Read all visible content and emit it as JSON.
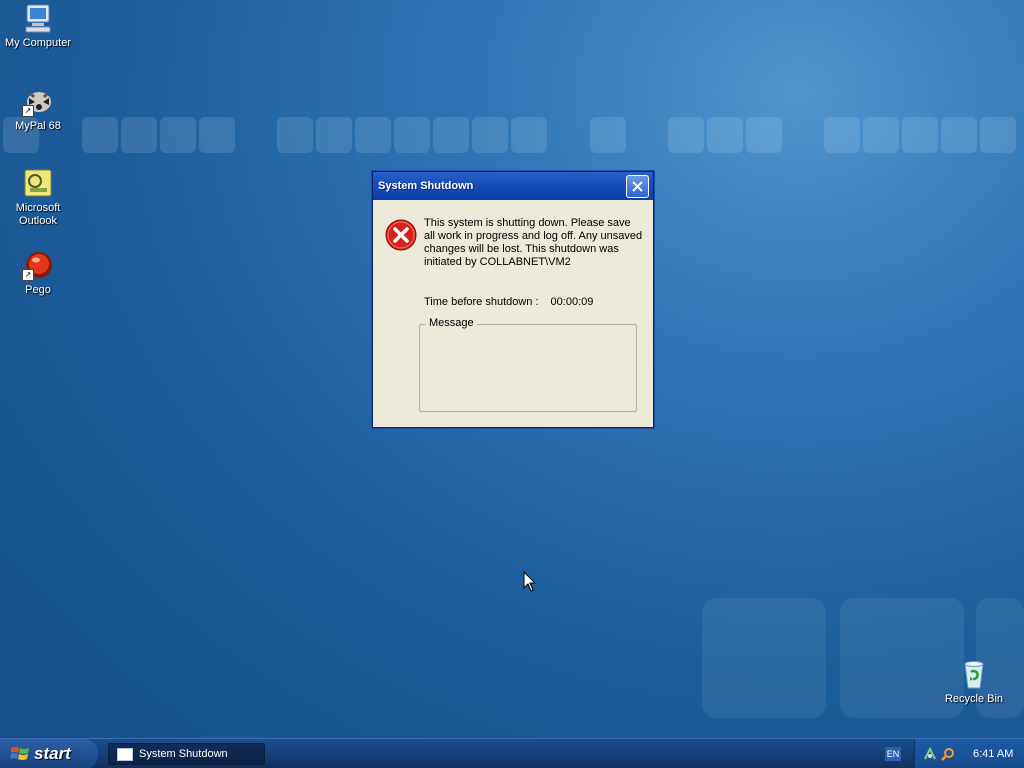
{
  "desktop": {
    "icons": [
      {
        "label": "My Computer",
        "icon": "my-computer-icon"
      },
      {
        "label": "MyPal 68",
        "icon": "mypal-icon"
      },
      {
        "label": "Microsoft Outlook",
        "icon": "outlook-icon"
      },
      {
        "label": "Pego",
        "icon": "pego-icon"
      },
      {
        "label": "Recycle Bin",
        "icon": "recycle-bin-icon"
      }
    ]
  },
  "dialog": {
    "title": "System Shutdown",
    "message": "This system is shutting down. Please save all work in progress and log off. Any unsaved changes will be lost. This shutdown was initiated by COLLABNET\\VM2",
    "time_label": "Time before shutdown :",
    "time_value": "00:00:09",
    "message_group_label": "Message",
    "message_group_text": ""
  },
  "taskbar": {
    "start_label": "start",
    "tasks": [
      {
        "label": "System Shutdown"
      }
    ],
    "language": "EN",
    "clock": "6:41 AM"
  },
  "colors": {
    "desktop_bg": "#1d5d9c",
    "titlebar": "#1a4fb8",
    "dialog_bg": "#ece9d8",
    "error_red": "#d8201c"
  }
}
